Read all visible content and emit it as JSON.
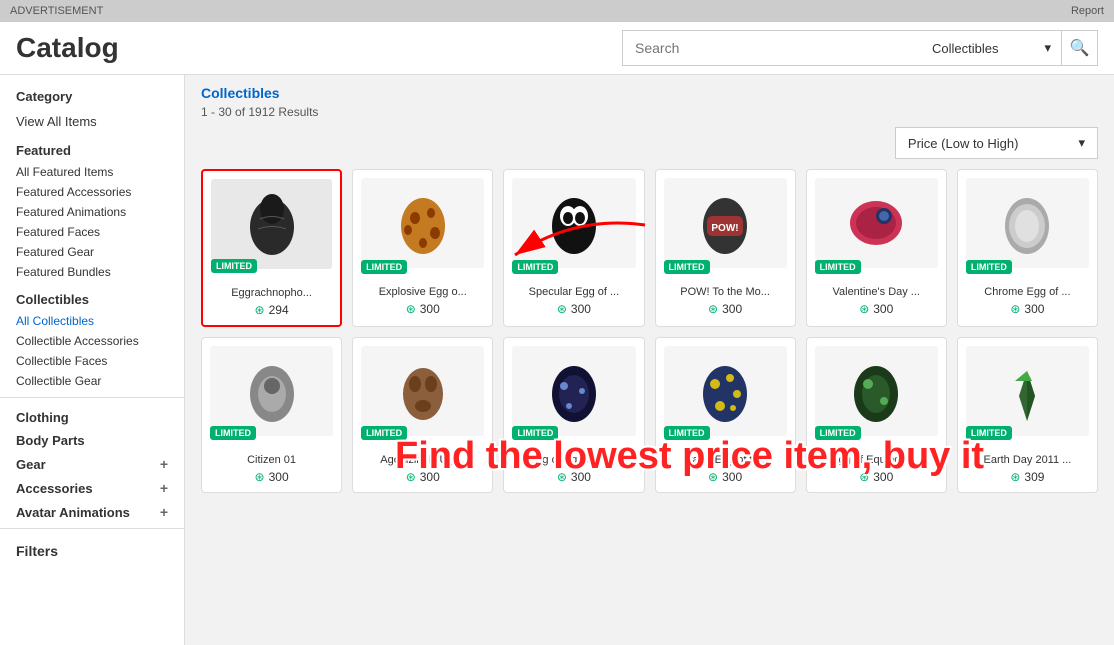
{
  "ad_bar": {
    "advertisement": "ADVERTISEMENT",
    "report": "Report"
  },
  "header": {
    "title": "Catalog",
    "search_placeholder": "Search",
    "category_selected": "Collectibles",
    "search_icon": "🔍"
  },
  "sidebar": {
    "category_label": "Category",
    "view_all_items": "View All Items",
    "featured_header": "Featured",
    "featured_items": [
      {
        "label": "All Featured Items"
      },
      {
        "label": "Featured Accessories"
      },
      {
        "label": "Featured Animations"
      },
      {
        "label": "Featured Faces"
      },
      {
        "label": "Featured Gear"
      },
      {
        "label": "Featured Bundles"
      }
    ],
    "collectibles_header": "Collectibles",
    "collectibles_items": [
      {
        "label": "All Collectibles",
        "active": true
      },
      {
        "label": "Collectible Accessories"
      },
      {
        "label": "Collectible Faces"
      },
      {
        "label": "Collectible Gear"
      }
    ],
    "clothing_header": "Clothing",
    "body_parts_header": "Body Parts",
    "gear_header": "Gear",
    "accessories_header": "Accessories",
    "avatar_animations_header": "Avatar Animations",
    "filters_header": "Filters"
  },
  "content": {
    "breadcrumb": "Collectibles",
    "results_text": "1 - 30 of 1912 Results",
    "sort_label": "Price (Low to High)",
    "items": [
      {
        "name": "Eggrachnopho...",
        "price": "294",
        "badge": "LIMITED",
        "selected": true
      },
      {
        "name": "Explosive Egg o...",
        "price": "300",
        "badge": "LIMITED",
        "selected": false
      },
      {
        "name": "Specular Egg of ...",
        "price": "300",
        "badge": "LIMITED",
        "selected": false
      },
      {
        "name": "POW! To the Mo...",
        "price": "300",
        "badge": "LIMITED",
        "selected": false
      },
      {
        "name": "Valentine's Day ...",
        "price": "300",
        "badge": "LIMITED",
        "selected": false
      },
      {
        "name": "Chrome Egg of ...",
        "price": "300",
        "badge": "LIMITED",
        "selected": false
      },
      {
        "name": "Citizen 01",
        "price": "300",
        "badge": "LIMITED",
        "selected": false
      },
      {
        "name": "Agonizingly Ugl...",
        "price": "300",
        "badge": "LIMITED",
        "selected": false
      },
      {
        "name": "Egg of Equinox: ...",
        "price": "300",
        "badge": "LIMITED",
        "selected": false
      },
      {
        "name": "Starry Egg of th...",
        "price": "300",
        "badge": "LIMITED",
        "selected": false
      },
      {
        "name": "Egg of Equinox: ...",
        "price": "300",
        "badge": "LIMITED",
        "selected": false
      },
      {
        "name": "Earth Day 2011 ...",
        "price": "309",
        "badge": "LIMITED",
        "selected": false
      }
    ],
    "overlay_text": "Find the lowest price item, buy it",
    "arrow_annotation": "→"
  },
  "item_colors": {
    "row1": [
      "#2a2a2a",
      "#c47a20",
      "#1a1a1a",
      "#333333",
      "#cc3355",
      "#aaaaaa"
    ],
    "row2": [
      "#888888",
      "#8b5e3c",
      "#222244",
      "#223366",
      "#1a3a1a",
      "#336633"
    ]
  }
}
